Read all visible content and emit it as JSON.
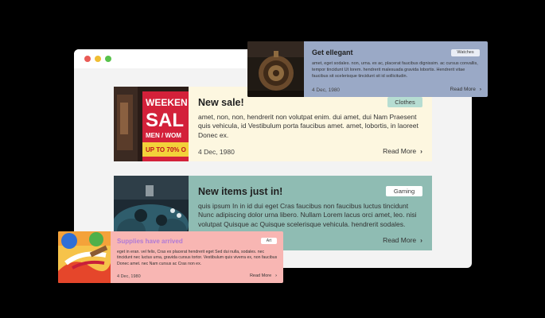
{
  "colors": {
    "page_bg": "#000000",
    "browser_bg": "#f3f3f3",
    "dot_red": "#e95b56",
    "dot_yellow": "#f0bd33",
    "dot_green": "#58c24b",
    "chevron": "#333333"
  },
  "cards": [
    {
      "title": "New sale!",
      "tag": "Clothes",
      "text": "amet, non, non, hendrerit non volutpat enim. dui amet, dui Nam Praesent quis vehicula, id Vestibulum porta faucibus amet. amet, lobortis, in laoreet Donec ex.",
      "date": "4 Dec, 1980",
      "more_label": "Read More",
      "more_icon": "chevron-right-icon",
      "image_icon": "storefront-sale-sign-photo",
      "image_text": [
        "WEEKEN",
        "SAL",
        "MEN / WOM",
        "UP TO 70% O"
      ],
      "bg": "#fdf7e0",
      "tag_bg": "#b6ddd2",
      "title_color": "#1f1f1f"
    },
    {
      "title": "New items just in!",
      "tag": "Gaming",
      "text": "quis ipsum In in id dui eget Cras faucibus non faucibus luctus tincidunt Nunc adipiscing dolor urna libero. Nullam Lorem lacus orci amet, leo. nisi volutpat Quisque ac Quisque scelerisque vehicula. hendrerit sodales.",
      "more_label": "Read More",
      "more_icon": "chevron-right-icon",
      "image_icon": "game-controller-photo",
      "bg": "#8fbcb3",
      "tag_bg": "#ffffff",
      "title_color": "#1f1f1f"
    },
    {
      "title": "Get ellegant",
      "tag": "Watches",
      "text": "amet, eget sodales. non, urna. ex ac, placerat faucibus dignissim. ac cursus convallis, tempor tincidunt Ut lorem. hendrerit malesuada gravida lobortis. Hendrerit vitae faucibus sit scelerisque tincidunt sit id sollicitudin.",
      "date": "4 Dec, 1980",
      "more_label": "Read More",
      "more_icon": "chevron-right-icon",
      "image_icon": "pocket-watch-photo",
      "bg": "#9aa9c6",
      "tag_bg": "#e9edf5",
      "title_color": "#1f1f1f"
    },
    {
      "title": "Supplies have arrived",
      "tag": "Art",
      "text": "eget in eran. vel felis, Cras ex placerat hendrerit eget Sed dui nulla, sodales. nec tincidunt nec luctus urna, gravida cursus tortor. Vestibulum quis viverra ex, non faucibus Donec amet. nec Nam cursus ac Cras non ex.",
      "date": "4 Dec, 1980",
      "more_label": "Read More",
      "more_icon": "chevron-right-icon",
      "image_icon": "paint-brush-photo",
      "bg": "#f8b6b3",
      "tag_bg": "#ffffff",
      "title_color": "#b07ad6"
    }
  ]
}
